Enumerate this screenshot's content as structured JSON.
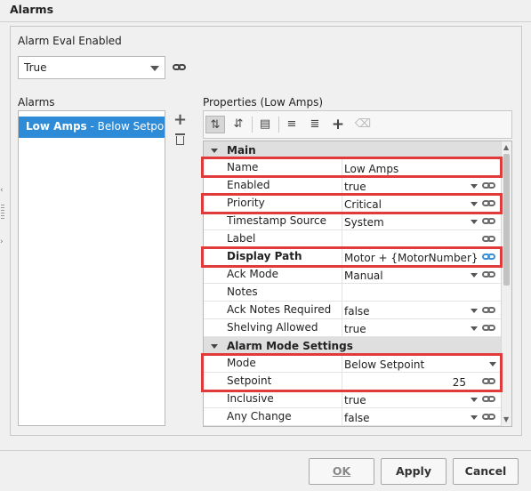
{
  "dialog": {
    "title": "Alarms"
  },
  "eval": {
    "label": "Alarm Eval Enabled",
    "value": "True"
  },
  "alarms": {
    "label": "Alarms",
    "selected_name": "Low Amps",
    "selected_desc": " - Below Setpoint,"
  },
  "properties": {
    "label": "Properties (Low Amps)",
    "rows": [
      {
        "type": "section",
        "name": "Main"
      },
      {
        "name": "Name",
        "value": "Low Amps"
      },
      {
        "name": "Enabled",
        "value": "true"
      },
      {
        "name": "Priority",
        "value": "Critical"
      },
      {
        "name": "Timestamp Source",
        "value": "System"
      },
      {
        "name": "Label",
        "value": ""
      },
      {
        "name": "Display Path",
        "value": "Motor + {MotorNumber}"
      },
      {
        "name": "Ack Mode",
        "value": "Manual"
      },
      {
        "name": "Notes",
        "value": ""
      },
      {
        "name": "Ack Notes Required",
        "value": "false"
      },
      {
        "name": "Shelving Allowed",
        "value": "true"
      },
      {
        "type": "section",
        "name": "Alarm Mode Settings"
      },
      {
        "name": "Mode",
        "value": "Below Setpoint"
      },
      {
        "name": "Setpoint",
        "value": "25"
      },
      {
        "name": "Inclusive",
        "value": "true"
      },
      {
        "name": "Any Change",
        "value": "false"
      }
    ]
  },
  "buttons": {
    "ok": "OK",
    "apply": "Apply",
    "cancel": "Cancel"
  },
  "colors": {
    "selection": "#2e8bd7",
    "highlight": "#e03a3a",
    "link_active": "#3a8fd6"
  }
}
